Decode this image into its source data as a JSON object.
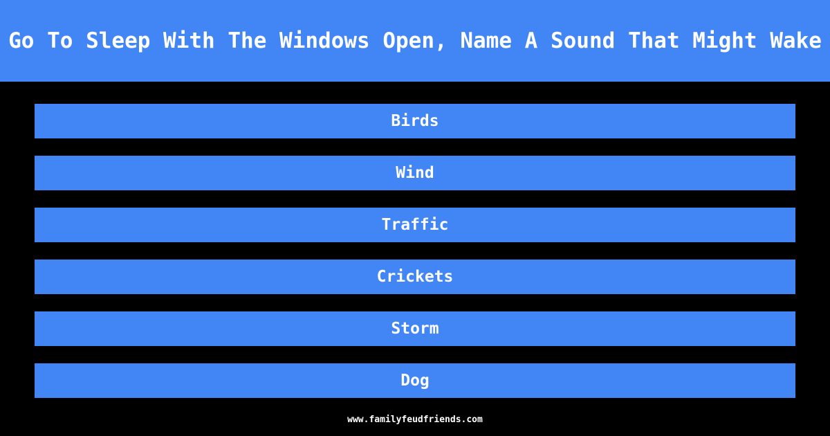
{
  "theme": {
    "background_color": "#000000",
    "accent_color": "#4285f4",
    "text_color": "#ffffff"
  },
  "header": {
    "question": "If You Go To Sleep With The Windows Open, Name A Sound That Might Wake You Up"
  },
  "answers": [
    {
      "rank": 1,
      "label": "Birds"
    },
    {
      "rank": 2,
      "label": "Wind"
    },
    {
      "rank": 3,
      "label": "Traffic"
    },
    {
      "rank": 4,
      "label": "Crickets"
    },
    {
      "rank": 5,
      "label": "Storm"
    },
    {
      "rank": 6,
      "label": "Dog"
    }
  ],
  "footer": {
    "site": "www.familyfeudfriends.com"
  }
}
